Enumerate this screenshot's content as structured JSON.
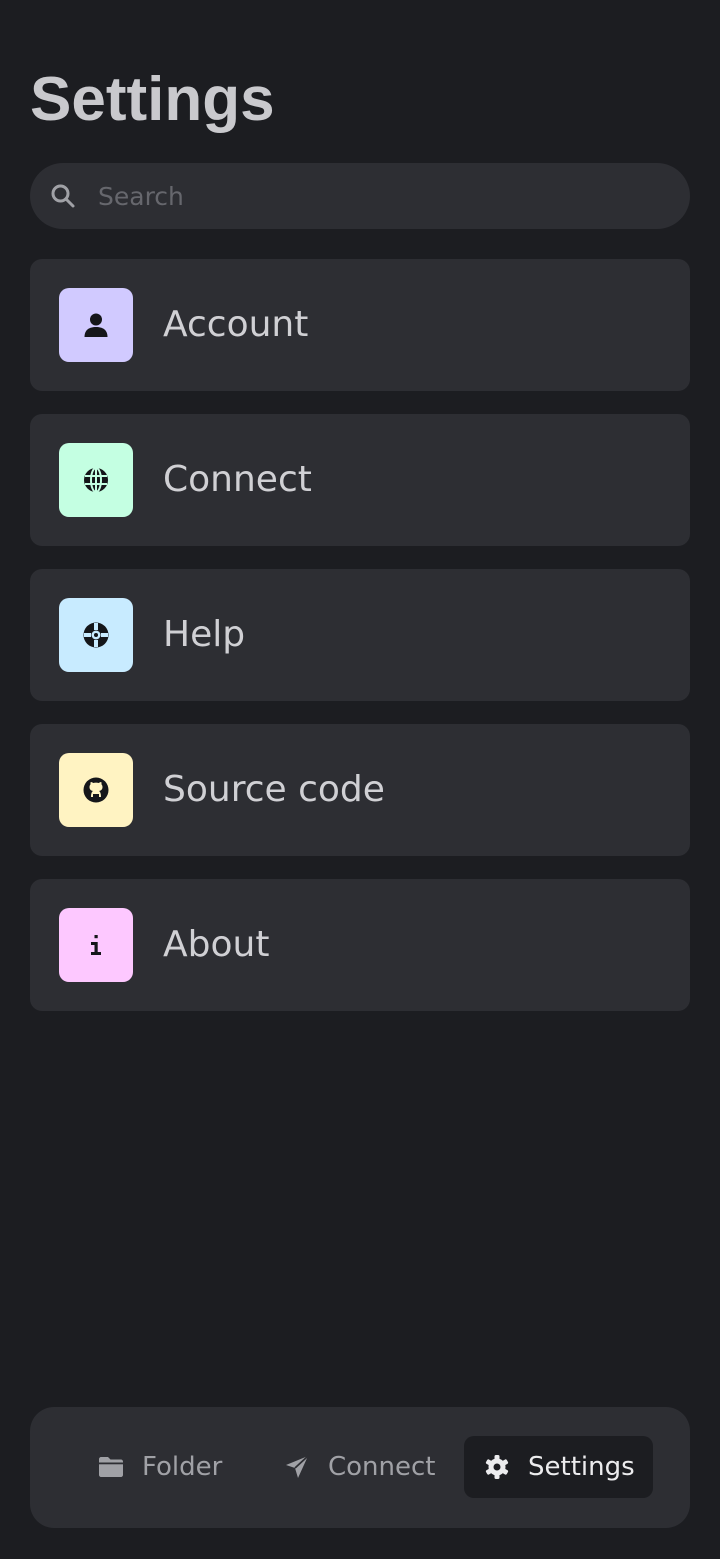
{
  "header": {
    "title": "Settings"
  },
  "search": {
    "placeholder": "Search",
    "value": ""
  },
  "menu": {
    "items": [
      {
        "label": "Account",
        "color": "#d1caff",
        "icon": "user-icon"
      },
      {
        "label": "Connect",
        "color": "#c4ffe2",
        "icon": "globe-icon"
      },
      {
        "label": "Help",
        "color": "#c8ebff",
        "icon": "lifebuoy-icon"
      },
      {
        "label": "Source code",
        "color": "#fff3c2",
        "icon": "github-icon"
      },
      {
        "label": "About",
        "color": "#fdc8ff",
        "icon": "info-icon"
      }
    ]
  },
  "nav": {
    "tabs": [
      {
        "label": "Folder",
        "icon": "folder-icon",
        "active": false
      },
      {
        "label": "Connect",
        "icon": "send-icon",
        "active": false
      },
      {
        "label": "Settings",
        "icon": "gear-icon",
        "active": true
      }
    ]
  },
  "colors": {
    "background": "#1c1d21",
    "surface": "#2d2e33"
  }
}
